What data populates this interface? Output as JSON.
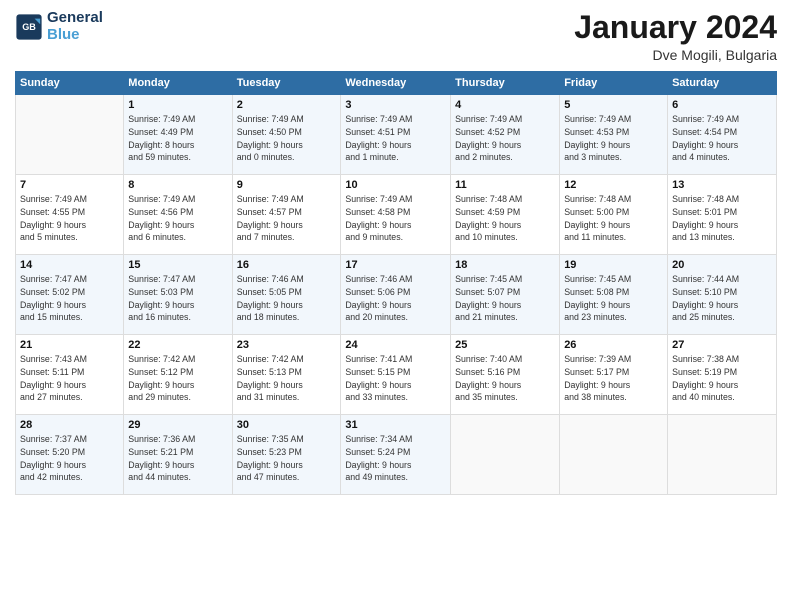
{
  "header": {
    "logo_line1": "General",
    "logo_line2": "Blue",
    "month": "January 2024",
    "location": "Dve Mogili, Bulgaria"
  },
  "days_of_week": [
    "Sunday",
    "Monday",
    "Tuesday",
    "Wednesday",
    "Thursday",
    "Friday",
    "Saturday"
  ],
  "weeks": [
    [
      {
        "num": "",
        "info": ""
      },
      {
        "num": "1",
        "info": "Sunrise: 7:49 AM\nSunset: 4:49 PM\nDaylight: 8 hours\nand 59 minutes."
      },
      {
        "num": "2",
        "info": "Sunrise: 7:49 AM\nSunset: 4:50 PM\nDaylight: 9 hours\nand 0 minutes."
      },
      {
        "num": "3",
        "info": "Sunrise: 7:49 AM\nSunset: 4:51 PM\nDaylight: 9 hours\nand 1 minute."
      },
      {
        "num": "4",
        "info": "Sunrise: 7:49 AM\nSunset: 4:52 PM\nDaylight: 9 hours\nand 2 minutes."
      },
      {
        "num": "5",
        "info": "Sunrise: 7:49 AM\nSunset: 4:53 PM\nDaylight: 9 hours\nand 3 minutes."
      },
      {
        "num": "6",
        "info": "Sunrise: 7:49 AM\nSunset: 4:54 PM\nDaylight: 9 hours\nand 4 minutes."
      }
    ],
    [
      {
        "num": "7",
        "info": "Sunrise: 7:49 AM\nSunset: 4:55 PM\nDaylight: 9 hours\nand 5 minutes."
      },
      {
        "num": "8",
        "info": "Sunrise: 7:49 AM\nSunset: 4:56 PM\nDaylight: 9 hours\nand 6 minutes."
      },
      {
        "num": "9",
        "info": "Sunrise: 7:49 AM\nSunset: 4:57 PM\nDaylight: 9 hours\nand 7 minutes."
      },
      {
        "num": "10",
        "info": "Sunrise: 7:49 AM\nSunset: 4:58 PM\nDaylight: 9 hours\nand 9 minutes."
      },
      {
        "num": "11",
        "info": "Sunrise: 7:48 AM\nSunset: 4:59 PM\nDaylight: 9 hours\nand 10 minutes."
      },
      {
        "num": "12",
        "info": "Sunrise: 7:48 AM\nSunset: 5:00 PM\nDaylight: 9 hours\nand 11 minutes."
      },
      {
        "num": "13",
        "info": "Sunrise: 7:48 AM\nSunset: 5:01 PM\nDaylight: 9 hours\nand 13 minutes."
      }
    ],
    [
      {
        "num": "14",
        "info": "Sunrise: 7:47 AM\nSunset: 5:02 PM\nDaylight: 9 hours\nand 15 minutes."
      },
      {
        "num": "15",
        "info": "Sunrise: 7:47 AM\nSunset: 5:03 PM\nDaylight: 9 hours\nand 16 minutes."
      },
      {
        "num": "16",
        "info": "Sunrise: 7:46 AM\nSunset: 5:05 PM\nDaylight: 9 hours\nand 18 minutes."
      },
      {
        "num": "17",
        "info": "Sunrise: 7:46 AM\nSunset: 5:06 PM\nDaylight: 9 hours\nand 20 minutes."
      },
      {
        "num": "18",
        "info": "Sunrise: 7:45 AM\nSunset: 5:07 PM\nDaylight: 9 hours\nand 21 minutes."
      },
      {
        "num": "19",
        "info": "Sunrise: 7:45 AM\nSunset: 5:08 PM\nDaylight: 9 hours\nand 23 minutes."
      },
      {
        "num": "20",
        "info": "Sunrise: 7:44 AM\nSunset: 5:10 PM\nDaylight: 9 hours\nand 25 minutes."
      }
    ],
    [
      {
        "num": "21",
        "info": "Sunrise: 7:43 AM\nSunset: 5:11 PM\nDaylight: 9 hours\nand 27 minutes."
      },
      {
        "num": "22",
        "info": "Sunrise: 7:42 AM\nSunset: 5:12 PM\nDaylight: 9 hours\nand 29 minutes."
      },
      {
        "num": "23",
        "info": "Sunrise: 7:42 AM\nSunset: 5:13 PM\nDaylight: 9 hours\nand 31 minutes."
      },
      {
        "num": "24",
        "info": "Sunrise: 7:41 AM\nSunset: 5:15 PM\nDaylight: 9 hours\nand 33 minutes."
      },
      {
        "num": "25",
        "info": "Sunrise: 7:40 AM\nSunset: 5:16 PM\nDaylight: 9 hours\nand 35 minutes."
      },
      {
        "num": "26",
        "info": "Sunrise: 7:39 AM\nSunset: 5:17 PM\nDaylight: 9 hours\nand 38 minutes."
      },
      {
        "num": "27",
        "info": "Sunrise: 7:38 AM\nSunset: 5:19 PM\nDaylight: 9 hours\nand 40 minutes."
      }
    ],
    [
      {
        "num": "28",
        "info": "Sunrise: 7:37 AM\nSunset: 5:20 PM\nDaylight: 9 hours\nand 42 minutes."
      },
      {
        "num": "29",
        "info": "Sunrise: 7:36 AM\nSunset: 5:21 PM\nDaylight: 9 hours\nand 44 minutes."
      },
      {
        "num": "30",
        "info": "Sunrise: 7:35 AM\nSunset: 5:23 PM\nDaylight: 9 hours\nand 47 minutes."
      },
      {
        "num": "31",
        "info": "Sunrise: 7:34 AM\nSunset: 5:24 PM\nDaylight: 9 hours\nand 49 minutes."
      },
      {
        "num": "",
        "info": ""
      },
      {
        "num": "",
        "info": ""
      },
      {
        "num": "",
        "info": ""
      }
    ]
  ]
}
